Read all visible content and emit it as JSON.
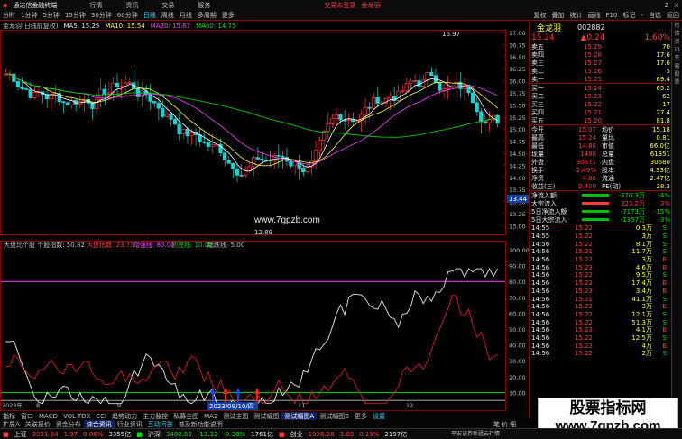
{
  "app": {
    "title": "通达信金融终端",
    "top_links": [
      "交易未登录",
      "金龙羽"
    ]
  },
  "titlebar": {
    "menu": [
      "行情",
      "资讯",
      "交易",
      "服务"
    ],
    "right": [
      "2",
      "×"
    ]
  },
  "menubar": {
    "left": [
      "分时",
      "1分钟",
      "5分钟",
      "15分钟",
      "30分钟",
      "60分钟",
      "日线",
      "周线",
      "月线",
      "多周期",
      "更多"
    ],
    "right": [
      "复权",
      "叠加",
      "统计",
      "画线",
      "F10",
      "标记",
      "-",
      "自选",
      "返回"
    ]
  },
  "chart_header": {
    "stock": "金龙羽(日线前复权)",
    "ma": [
      {
        "label": "MA5: 15.25",
        "color": "#ffffff"
      },
      {
        "label": "MA10: 15.54",
        "color": "#ffff40"
      },
      {
        "label": "MA20: 15.67",
        "color": "#ff40ff"
      },
      {
        "label": "MA60: 14.75",
        "color": "#00e000"
      }
    ]
  },
  "price_axis": [
    "17.00",
    "16.75",
    "16.50",
    "16.25",
    "16.00",
    "15.75",
    "15.50",
    "15.25",
    "15.00",
    "14.75",
    "14.50",
    "14.25",
    "14.00",
    "13.75",
    "13.50",
    "13.25",
    "13.00"
  ],
  "price_marks": {
    "high": "16.97",
    "low": "12.89",
    "current_tag": "13.44"
  },
  "indicator_header": {
    "name": "大盘比个股 个股指数: 50.82",
    "items": [
      {
        "label": "大盘指数: 23.73",
        "color": "#ff3b3b"
      },
      {
        "label": "增强线: 80.00",
        "color": "#ff40ff"
      },
      {
        "label": "抄底线: 10.00",
        "color": "#00e000"
      },
      {
        "label": "超跌线: 5.00",
        "color": "#c0c0c0"
      }
    ]
  },
  "indicator_axis": [
    "100.00",
    "90.00",
    "80.00",
    "70.00",
    "60.00",
    "50.00",
    "40.00",
    "30.00",
    "20.00",
    "10.00"
  ],
  "x_axis": {
    "labels": [
      "2023年",
      "8",
      "9",
      "10",
      "11",
      "12"
    ],
    "date_tag": "2023/08/10/四"
  },
  "watermark_mid": "www.7gpzb.com",
  "quote": {
    "name": "金龙羽",
    "code": "002882",
    "price": "15.24",
    "change": "▲0.24",
    "pct": "1.60%",
    "asks": [
      {
        "label": "卖五",
        "price": "15.29",
        "vol": "70"
      },
      {
        "label": "卖四",
        "price": "15.28",
        "vol": "17.6"
      },
      {
        "label": "卖三",
        "price": "15.27",
        "vol": "17.6"
      },
      {
        "label": "卖二",
        "price": "15.26",
        "vol": "5"
      },
      {
        "label": "卖一",
        "price": "15.25",
        "vol": "69.4"
      }
    ],
    "bids": [
      {
        "label": "买一",
        "price": "15.24",
        "vol": "65.2"
      },
      {
        "label": "买二",
        "price": "15.23",
        "vol": "62"
      },
      {
        "label": "买三",
        "price": "15.22",
        "vol": "17"
      },
      {
        "label": "买四",
        "price": "15.21",
        "vol": "27.4"
      },
      {
        "label": "买五",
        "price": "15.20",
        "vol": "81.8"
      }
    ],
    "stats": [
      {
        "k1": "今开",
        "v1": "15.07",
        "k2": "均价",
        "v2": "15.18"
      },
      {
        "k1": "最高",
        "v1": "15.24",
        "k2": "量比",
        "v2": "0.81"
      },
      {
        "k1": "最低",
        "v1": "14.88",
        "k2": "市值",
        "v2": "66.0亿"
      },
      {
        "k1": "现量",
        "v1": "1488",
        "k2": "总量",
        "v2": "61351"
      },
      {
        "k1": "外盘",
        "v1": "30671",
        "k2": "内盘",
        "v2": "30680"
      },
      {
        "k1": "换手",
        "v1": "2.49%",
        "k2": "股本",
        "v2": "4.33亿"
      },
      {
        "k1": "净资",
        "v1": "4.86",
        "k2": "流通",
        "v2": "2.47亿"
      },
      {
        "k1": "收益(三)",
        "v1": "0.400",
        "k2": "PE(动)",
        "v2": "28.3"
      }
    ],
    "flows": [
      {
        "label": "净流入额",
        "value": "-370.3万",
        "pct": "-4%"
      },
      {
        "label": "大宗流入",
        "value": "323.2万",
        "pct": "3%"
      },
      {
        "label": "5日净流入额",
        "value": "-7173万",
        "pct": "-15%"
      },
      {
        "label": "5日大宗流入",
        "value": "-1357万",
        "pct": "-3%"
      }
    ],
    "ticks": [
      {
        "t": "14:55",
        "p": "15.22",
        "v": "0.3万",
        "s": "S"
      },
      {
        "t": "14:55",
        "p": "15.22",
        "v": "3万",
        "s": "S"
      },
      {
        "t": "14:56",
        "p": "15.22",
        "v": "8.1万",
        "s": "S"
      },
      {
        "t": "14:56",
        "p": "15.21",
        "v": "11.7万",
        "s": "S"
      },
      {
        "t": "14:56",
        "p": "15.22",
        "v": "3万",
        "s": "B"
      },
      {
        "t": "14:56",
        "p": "15.23",
        "v": "4.6万",
        "s": "B"
      },
      {
        "t": "14:56",
        "p": "15.22",
        "v": "9.5万",
        "s": "S"
      },
      {
        "t": "14:56",
        "p": "15.23",
        "v": "17.4万",
        "s": "B"
      },
      {
        "t": "14:56",
        "p": "15.23",
        "v": "3.4万",
        "s": "B"
      },
      {
        "t": "14:56",
        "p": "15.21",
        "v": "41.1万",
        "s": "S"
      },
      {
        "t": "14:56",
        "p": "15.22",
        "v": "3万",
        "s": "B"
      },
      {
        "t": "14:56",
        "p": "15.22",
        "v": "12.1万",
        "s": "S"
      },
      {
        "t": "14:56",
        "p": "15.22",
        "v": "51.3万",
        "s": "S"
      },
      {
        "t": "14:56",
        "p": "15.23",
        "v": "4.1万",
        "s": "B"
      },
      {
        "t": "14:56",
        "p": "15.22",
        "v": "12.5万",
        "s": "S"
      },
      {
        "t": "14:56",
        "p": "15.23",
        "v": "4万",
        "s": "B"
      },
      {
        "t": "14:56",
        "p": "15.22",
        "v": "2万",
        "s": "S"
      }
    ]
  },
  "bottom_tabs": [
    "指标",
    "窗口",
    "MACD",
    "VOL-TDX",
    "CCI",
    "趋势动力",
    "主力监控",
    "私募主图",
    "MA2",
    "测试主图",
    "测试幅图",
    "测试幅图A",
    "测试幅图B",
    "更多",
    "设置"
  ],
  "bottom_tabs2": [
    "扩展A",
    "关联报价",
    "资金分布",
    "综合资讯",
    "行业资讯",
    "互动问答",
    "普及新功能说明"
  ],
  "right_bottom_tabs": [
    "笔",
    "价",
    "细",
    "盘",
    "势",
    "指",
    "联"
  ],
  "right_bottom_caption": [
    "平安证券新疆云行情"
  ],
  "statusbar": [
    {
      "name": "上证",
      "value": "3031.64",
      "chg": "1.97",
      "pct": "0.06%",
      "vol": "3355亿"
    },
    {
      "name": "沪深",
      "value": "3482.88",
      "chg": "-13.32",
      "pct": "-0.38%",
      "vol": "1761亿"
    },
    {
      "name": "创业",
      "value": "1926.28",
      "chg": "3.69",
      "pct": "0.19%",
      "vol": "2197亿"
    }
  ],
  "watermark_box": {
    "line1": "股票指标网",
    "line2": "www.7gpzb.com"
  },
  "sidebar": [
    "行",
    "情",
    "资",
    "讯",
    "交",
    "易",
    "股",
    "票"
  ]
}
